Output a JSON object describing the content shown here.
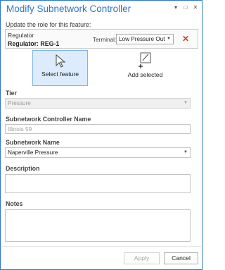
{
  "window": {
    "title": "Modify Subnetwork Controller"
  },
  "role_prompt": "Update the role for this feature:",
  "feature": {
    "type": "Regulator",
    "id_label": "Regulator: REG-1",
    "terminal_label": "Terminal:",
    "terminal_value": "Low Pressure Out"
  },
  "tools": {
    "select_feature": "Select feature",
    "add_selected": "Add selected"
  },
  "tier": {
    "label": "Tier",
    "value": "Pressure"
  },
  "controller_name": {
    "label": "Subnetwork Controller Name",
    "placeholder": "Illinois 59"
  },
  "subnetwork_name": {
    "label": "Subnetwork Name",
    "value": "Naperville Pressure"
  },
  "description": {
    "label": "Description",
    "value": ""
  },
  "notes": {
    "label": "Notes",
    "value": ""
  },
  "buttons": {
    "apply": "Apply",
    "cancel": "Cancel"
  },
  "colors": {
    "accent": "#2d77c8",
    "remove": "#d0441c",
    "active_tool": "#dcecfc"
  }
}
